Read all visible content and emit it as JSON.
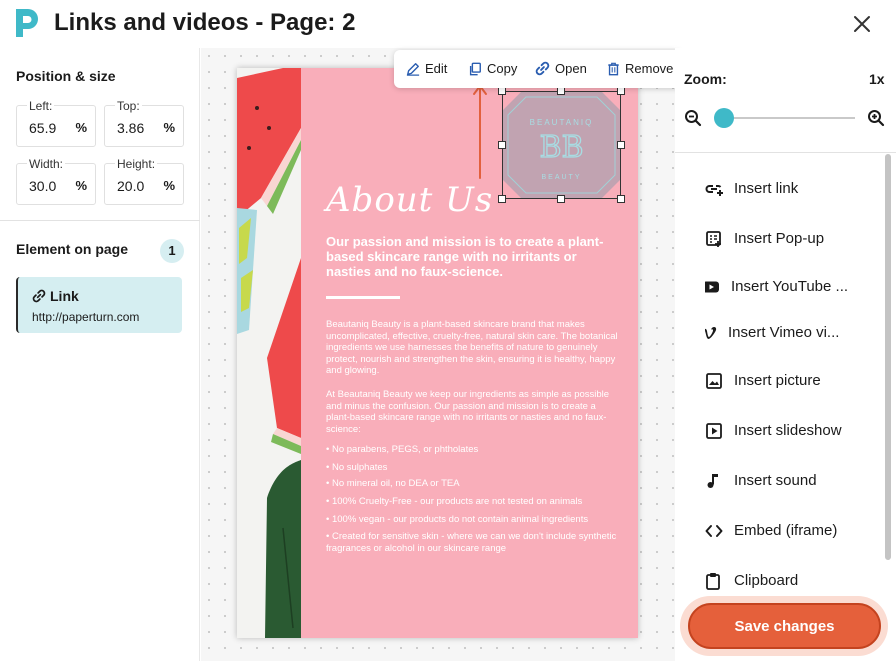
{
  "header": {
    "title": "Links and videos - Page: 2",
    "logo_icon": "paperturn-logo-icon",
    "close_icon": "close-icon"
  },
  "position_size": {
    "title": "Position & size",
    "left": {
      "label": "Left:",
      "value": "65.9",
      "unit": "%"
    },
    "top": {
      "label": "Top:",
      "value": "3.86",
      "unit": "%"
    },
    "width": {
      "label": "Width:",
      "value": "30.0",
      "unit": "%"
    },
    "height": {
      "label": "Height:",
      "value": "20.0",
      "unit": "%"
    }
  },
  "elements": {
    "title": "Element on page",
    "count": "1",
    "items": [
      {
        "type": "Link",
        "url": "http://paperturn.com",
        "icon": "link-icon"
      }
    ]
  },
  "toolbar": {
    "edit": "Edit",
    "copy": "Copy",
    "open": "Open",
    "remove": "Remove"
  },
  "page_content": {
    "heading": "About Us",
    "lead": "Our passion and mission is to create a plant-based skincare range with no irritants or nasties and no faux-science.",
    "para1": "Beautaniq Beauty is a plant-based skincare brand that makes uncomplicated, effective, cruelty-free, natural skin care. The botanical ingredients we use harnesses the benefits of nature to genuinely protect, nourish and strengthen the skin, ensuring it is healthy, happy and glowing.",
    "para2": "At Beautaniq Beauty we keep our ingredients as simple as possible and minus the confusion. Our passion and mission is to create a plant-based skincare range with no irritants or nasties and no faux-science:",
    "bullets": [
      "• No parabens, PEGS, or phtholates",
      "• No sulphates",
      "• No mineral oil, no DEA or TEA",
      "• 100% Cruelty-Free - our products are not tested on animals",
      "• 100% vegan - our products do not contain animal ingredients",
      "• Created for sensitive skin - where we can we don't include synthetic fragrances or alcohol in our skincare range"
    ],
    "logo_initials": "BB",
    "logo_top_text": "BEAUTANIQ",
    "logo_bottom_text": "BEAUTY"
  },
  "zoom": {
    "label": "Zoom:",
    "value": "1x",
    "level": 0
  },
  "insert_menu": [
    {
      "label": "Insert link",
      "icon": "insert-link-icon"
    },
    {
      "label": "Insert Pop-up",
      "icon": "popup-icon"
    },
    {
      "label": "Insert YouTube ...",
      "icon": "youtube-icon"
    },
    {
      "label": "Insert Vimeo vi...",
      "icon": "vimeo-icon"
    },
    {
      "label": "Insert picture",
      "icon": "picture-icon"
    },
    {
      "label": "Insert slideshow",
      "icon": "slideshow-icon"
    },
    {
      "label": "Insert sound",
      "icon": "music-note-icon"
    },
    {
      "label": "Embed (iframe)",
      "icon": "code-icon"
    },
    {
      "label": "Clipboard",
      "icon": "clipboard-icon"
    }
  ],
  "save_label": "Save changes",
  "colors": {
    "accent": "#e5603b",
    "teal": "#3fb9c8",
    "page_pink": "#f9aeba",
    "card_bg": "#d5eef1"
  }
}
